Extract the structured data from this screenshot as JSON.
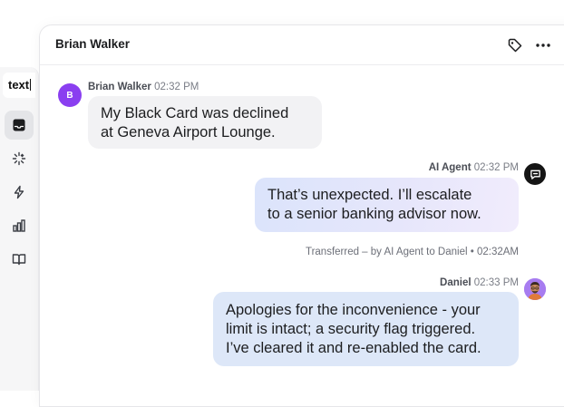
{
  "rail": {
    "brand_text": "text",
    "items": [
      {
        "icon": "inbox-icon",
        "active": true
      },
      {
        "icon": "sparkle-icon",
        "active": false
      },
      {
        "icon": "lightning-icon",
        "active": false
      },
      {
        "icon": "bar-chart-icon",
        "active": false
      },
      {
        "icon": "book-icon",
        "active": false
      }
    ]
  },
  "header": {
    "title": "Brian Walker",
    "actions": [
      "tag-icon",
      "more-icon"
    ]
  },
  "messages": [
    {
      "sender": "Brian Walker",
      "time": "02:32 PM",
      "avatar_initial": "B",
      "lines": [
        "My Black Card was declined",
        "at Geneva Airport Lounge."
      ]
    },
    {
      "sender": "AI Agent",
      "time": "02:32 PM",
      "lines": [
        "That’s unexpected. I’ll escalate",
        "to a senior banking advisor now."
      ]
    },
    {
      "sender": "Daniel",
      "time": "02:33 PM",
      "lines": [
        "Apologies for the inconvenience - your",
        "limit is intact; a security flag triggered.",
        "I’ve cleared it and re-enabled the card."
      ]
    }
  ],
  "transfer_note": {
    "text": "Transferred – by AI Agent to Daniel",
    "time": "• 02:32AM"
  },
  "colors": {
    "avatar_b": "#8a3ff0",
    "customer_bubble": "#f2f2f4",
    "agent_bubble": "#dde7f8"
  }
}
